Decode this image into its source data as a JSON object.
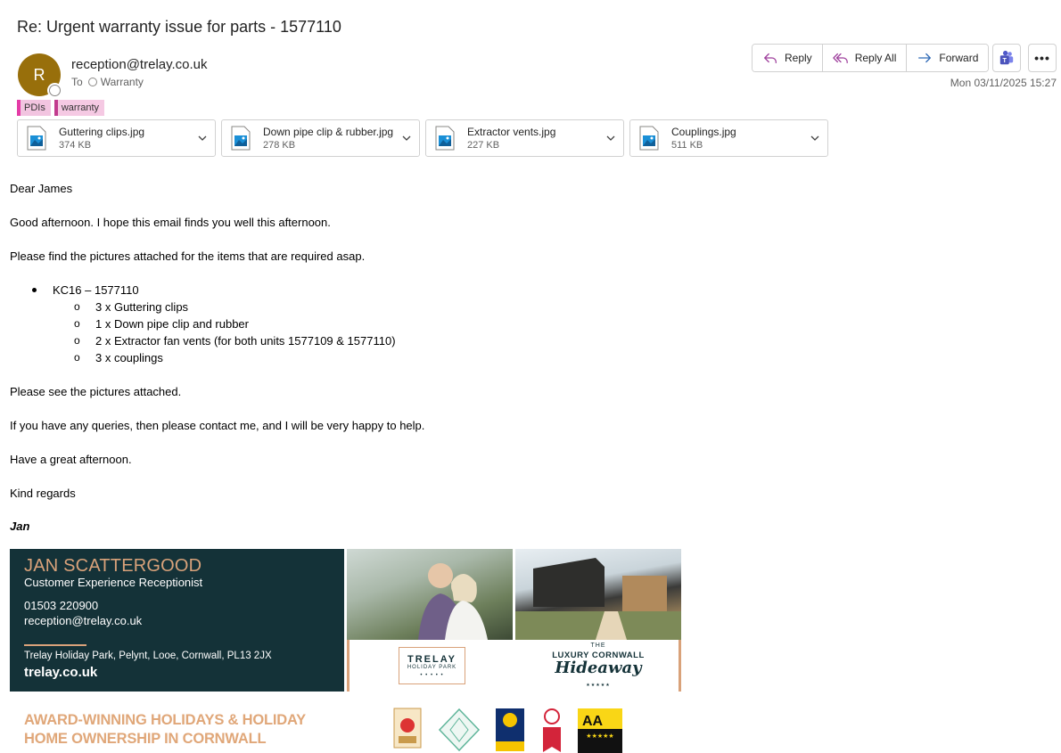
{
  "email": {
    "subject": "Re: Urgent warranty issue for parts - 1577110",
    "avatar_initial": "R",
    "sender": "reception@trelay.co.uk",
    "to_label": "To",
    "to_recipient": "Warranty",
    "timestamp": "Mon 03/11/2025 15:27"
  },
  "actions": {
    "reply": "Reply",
    "reply_all": "Reply All",
    "forward": "Forward"
  },
  "tags": [
    {
      "label": "PDIs",
      "color": "#e43ba6"
    },
    {
      "label": "warranty",
      "color": "#c23b8e"
    }
  ],
  "attachments": [
    {
      "name": "Guttering clips.jpg",
      "size": "374 KB"
    },
    {
      "name": "Down pipe clip & rubber.jpg",
      "size": "278 KB"
    },
    {
      "name": "Extractor vents.jpg",
      "size": "227 KB"
    },
    {
      "name": "Couplings.jpg",
      "size": "511 KB"
    }
  ],
  "body": {
    "greeting": "Dear James",
    "line1": "Good afternoon. I hope this email finds you well this afternoon.",
    "line2": "Please find the pictures attached for the items that are required asap.",
    "bullet": "KC16 – 1577110",
    "sub_items": [
      "3 x Guttering clips",
      "1 x Down pipe clip and rubber",
      "2 x Extractor fan vents (for both units 1577109 & 1577110)",
      "3 x couplings"
    ],
    "line3": "Please see the pictures attached.",
    "line4": "If you have any queries, then please contact me, and I will be very happy to help.",
    "line5": "Have a great afternoon.",
    "closing": "Kind regards",
    "signature": "Jan"
  },
  "signature_banner": {
    "name": "JAN SCATTERGOOD",
    "title": "Customer Experience Receptionist",
    "phone": "01503 220900",
    "email": "reception@trelay.co.uk",
    "address": "Trelay Holiday Park, Pelynt, Looe, Cornwall, PL13 2JX",
    "website": "trelay.co.uk",
    "logo1_main": "TRELAY",
    "logo1_sub": "HOLIDAY PARK",
    "logo2_top": "THE",
    "logo2_mid": "LUXURY CORNWALL",
    "logo2_script": "Hideaway",
    "award_line1": "AWARD-WINNING HOLIDAYS & HOLIDAY",
    "award_line2": "HOME OWNERSHIP IN CORNWALL"
  },
  "colors": {
    "avatar": "#986f0b",
    "banner_dark": "#143238",
    "banner_accent": "#d9a27a"
  }
}
